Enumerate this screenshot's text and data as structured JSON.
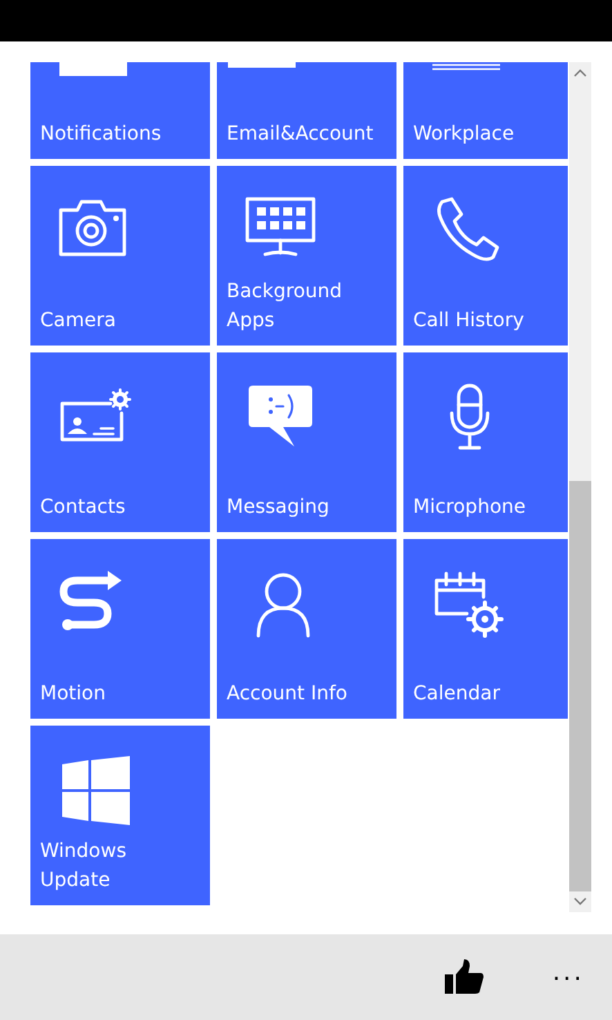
{
  "rows": [
    {
      "tiles": [
        {
          "label": "Notifications"
        },
        {
          "label": "Email&Account"
        },
        {
          "label": "Workplace"
        }
      ]
    },
    {
      "tiles": [
        {
          "label": "Camera"
        },
        {
          "label": "Background\nApps"
        },
        {
          "label": "Call History"
        }
      ]
    },
    {
      "tiles": [
        {
          "label": "Contacts"
        },
        {
          "label": "Messaging"
        },
        {
          "label": "Microphone"
        }
      ]
    },
    {
      "tiles": [
        {
          "label": "Motion"
        },
        {
          "label": "Account Info"
        },
        {
          "label": "Calendar"
        }
      ]
    },
    {
      "tiles": [
        {
          "label": "Windows\nUpdate"
        }
      ]
    }
  ],
  "app_bar": {
    "more": "..."
  }
}
